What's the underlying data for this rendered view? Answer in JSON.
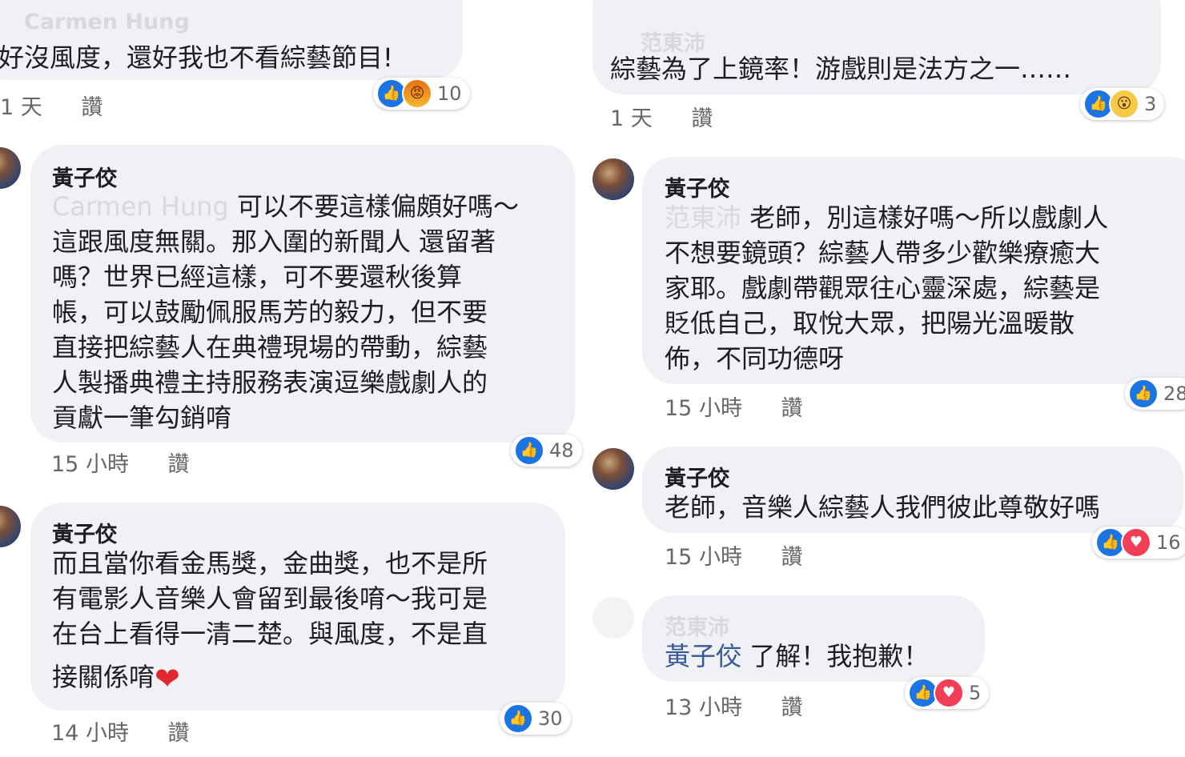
{
  "left": {
    "c0": {
      "name_faded": "Carmen Hung",
      "text": "好沒風度，還好我也不看綜藝節目!",
      "time": "1 天",
      "action": "讚",
      "reaction_icons": [
        "like",
        "angry"
      ],
      "reaction_count": "10"
    },
    "c1": {
      "name": "黃子佼",
      "mention_faded": "Carmen Hung",
      "text_first": "可以不要這樣偏頗好嗎～",
      "lines": [
        "這跟風度無關。那入圍的新聞人 還留著",
        "嗎？世界已經這樣，可不要還秋後算",
        "帳，可以鼓勵佩服馬芳的毅力，但不要",
        "直接把綜藝人在典禮現場的帶動，綜藝",
        "人製播典禮主持服務表演逗樂戲劇人的",
        "貢獻一筆勾銷唷"
      ],
      "time": "15 小時",
      "action": "讚",
      "reaction_icons": [
        "like"
      ],
      "reaction_count": "48"
    },
    "c2": {
      "name": "黃子佼",
      "lines": [
        "而且當你看金馬獎，金曲獎，也不是所",
        "有電影人音樂人會留到最後唷～我可是",
        "在台上看得一清二楚。與風度，不是直"
      ],
      "last_line": "接關係唷",
      "emoji": "heart",
      "time": "14 小時",
      "action": "讚",
      "reaction_icons": [
        "like"
      ],
      "reaction_count": "30"
    }
  },
  "right": {
    "c0": {
      "name_faded": "范東沛",
      "text": "綜藝為了上鏡率！游戲則是法方之一……",
      "time": "1 天",
      "action": "讚",
      "reaction_icons": [
        "like",
        "wow"
      ],
      "reaction_count": "3"
    },
    "c1": {
      "name": "黃子佼",
      "mention_faded": "范東沛",
      "text_first": "老師，別這樣好嗎～所以戲劇人",
      "lines": [
        "不想要鏡頭？綜藝人帶多少歡樂療癒大",
        "家耶。戲劇帶觀眾往心靈深處，綜藝是",
        "貶低自己，取悅大眾，把陽光溫暖散",
        "佈，不同功德呀"
      ],
      "time": "15 小時",
      "action": "讚",
      "reaction_icons": [
        "like"
      ],
      "reaction_count": "28"
    },
    "c2": {
      "name": "黃子佼",
      "text": "老師，音樂人綜藝人我們彼此尊敬好嗎",
      "time": "15 小時",
      "action": "讚",
      "reaction_icons": [
        "like",
        "love"
      ],
      "reaction_count": "16"
    },
    "c3": {
      "name_faded": "范東沛",
      "mention": "黃子佼",
      "text": "了解！我抱歉！",
      "time": "13 小時",
      "action": "讚",
      "reaction_icons": [
        "like",
        "love"
      ],
      "reaction_count": "5"
    }
  },
  "colors": {
    "bubble": "#eff1f4",
    "like": "#1b74e4",
    "love": "#f33e58",
    "link": "#385898",
    "meta": "#65676b"
  }
}
